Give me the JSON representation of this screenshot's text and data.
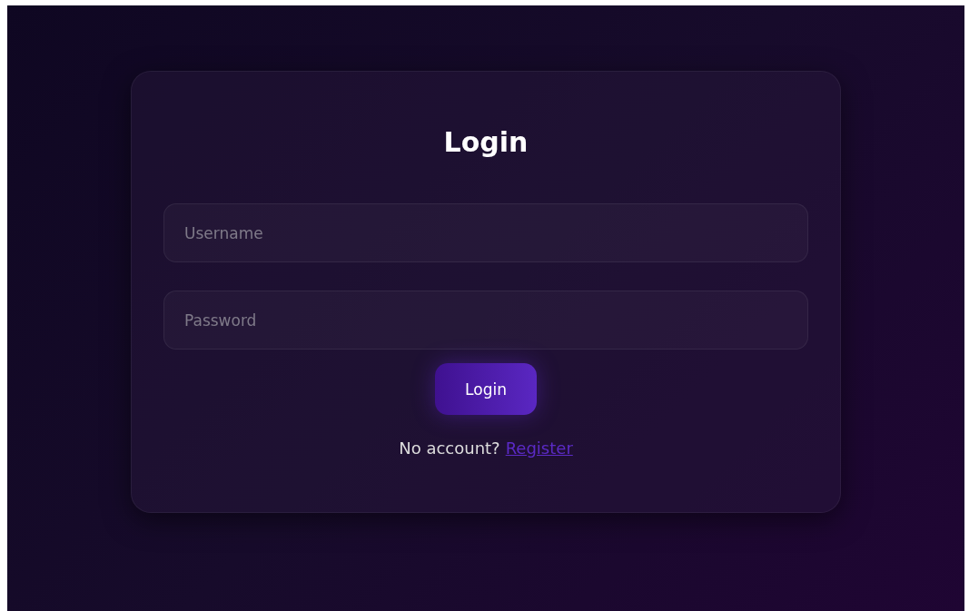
{
  "title": "Login",
  "fields": [
    {
      "placeholder": "Username"
    },
    {
      "placeholder": "Password"
    }
  ],
  "button": "Login",
  "footer": {
    "text": "No account?",
    "link": "Register"
  }
}
